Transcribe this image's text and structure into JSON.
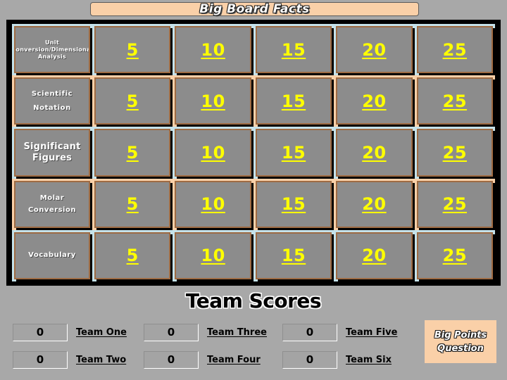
{
  "header": {
    "title": "Big Board Facts",
    "banner_color": "#fad0a8"
  },
  "board": {
    "frame_color": "#000000",
    "cell_color": "#8c8c8c",
    "cell_border_color": "#9e6b43",
    "value_color": "#ffff00",
    "separator_colors": [
      "#c5e2ea",
      "#fad0a8"
    ],
    "rows": [
      {
        "category": "Unit Conversion/Dimensional Analysis",
        "values": [
          "5",
          "10",
          "15",
          "20",
          "25"
        ]
      },
      {
        "category": "Scientific Notation",
        "values": [
          "5",
          "10",
          "15",
          "20",
          "25"
        ]
      },
      {
        "category": "Significant Figures",
        "values": [
          "5",
          "10",
          "15",
          "20",
          "25"
        ]
      },
      {
        "category": "Molar Conversion",
        "values": [
          "5",
          "10",
          "15",
          "20",
          "25"
        ]
      },
      {
        "category": "Vocabulary",
        "values": [
          "5",
          "10",
          "15",
          "20",
          "25"
        ]
      }
    ]
  },
  "scores": {
    "title": "Team Scores",
    "teams": [
      {
        "score": "0",
        "label": "Team One"
      },
      {
        "score": "0",
        "label": "Team Two"
      },
      {
        "score": "0",
        "label": "Team Three"
      },
      {
        "score": "0",
        "label": "Team Four"
      },
      {
        "score": "0",
        "label": "Team Five"
      },
      {
        "score": "0",
        "label": "Team Six"
      }
    ]
  },
  "big_points": {
    "line1": "Big Points",
    "line2": "Question",
    "background": "#fad0a8"
  }
}
